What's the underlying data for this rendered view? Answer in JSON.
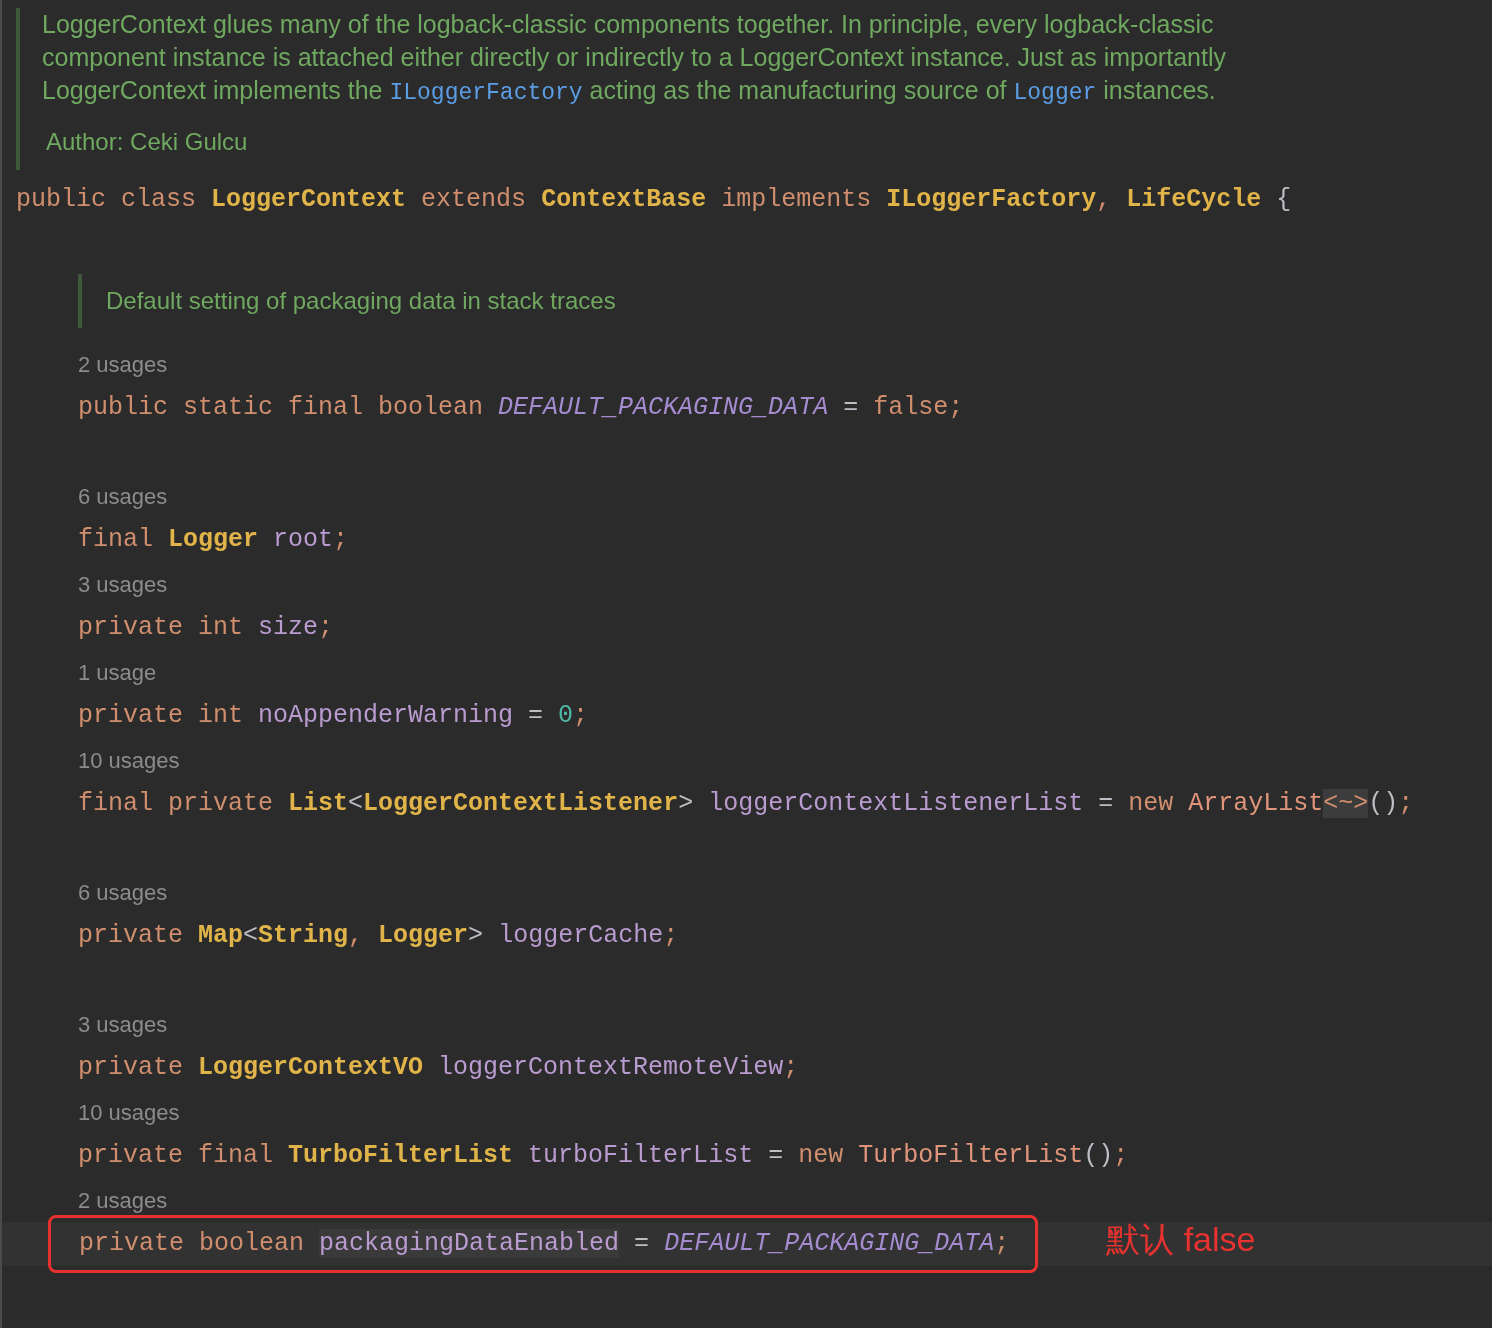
{
  "doc_comment": {
    "paragraph": [
      {
        "kind": "text",
        "text": "LoggerContext glues many of the logback-classic components together. In principle, every logback-classic component instance is attached either directly or indirectly to a LoggerContext instance. Just as importantly LoggerContext implements the "
      },
      {
        "kind": "code",
        "text": "ILoggerFactory"
      },
      {
        "kind": "text",
        "text": " acting as the manufacturing source of "
      },
      {
        "kind": "code",
        "text": "Logger"
      },
      {
        "kind": "text",
        "text": " instances."
      }
    ],
    "author": "Author: Ceki Gulcu"
  },
  "class_declaration": [
    {
      "text": "public class ",
      "kind": "kw"
    },
    {
      "text": "LoggerContext",
      "kind": "type"
    },
    {
      "text": " extends ",
      "kind": "kw"
    },
    {
      "text": "ContextBase",
      "kind": "type"
    },
    {
      "text": " implements ",
      "kind": "kw"
    },
    {
      "text": "ILoggerFactory",
      "kind": "type"
    },
    {
      "text": ", ",
      "kind": "kw"
    },
    {
      "text": "LifeCycle",
      "kind": "type"
    },
    {
      "text": " {",
      "kind": "op"
    }
  ],
  "members": [
    {
      "kind": "blank"
    },
    {
      "kind": "doc",
      "text": "Default setting of packaging data in stack traces"
    },
    {
      "kind": "usages",
      "text": "2 usages"
    },
    {
      "kind": "code",
      "boxed": false,
      "tokens": [
        {
          "text": "public static final boolean ",
          "kind": "kw"
        },
        {
          "text": "DEFAULT_PACKAGING_DATA",
          "kind": "const"
        },
        {
          "text": " = ",
          "kind": "op"
        },
        {
          "text": "false",
          "kind": "kw"
        },
        {
          "text": ";",
          "kind": "kw"
        }
      ]
    },
    {
      "kind": "blank"
    },
    {
      "kind": "usages",
      "text": "6 usages"
    },
    {
      "kind": "code",
      "boxed": false,
      "tokens": [
        {
          "text": "final ",
          "kind": "kw"
        },
        {
          "text": "Logger",
          "kind": "type"
        },
        {
          "text": " root",
          "kind": "field"
        },
        {
          "text": ";",
          "kind": "kw"
        }
      ]
    },
    {
      "kind": "usages",
      "text": "3 usages"
    },
    {
      "kind": "code",
      "boxed": false,
      "tokens": [
        {
          "text": "private int ",
          "kind": "kw"
        },
        {
          "text": "size",
          "kind": "field"
        },
        {
          "text": ";",
          "kind": "kw"
        }
      ]
    },
    {
      "kind": "usages",
      "text": "1 usage"
    },
    {
      "kind": "code",
      "boxed": false,
      "tokens": [
        {
          "text": "private int ",
          "kind": "kw"
        },
        {
          "text": "noAppenderWarning",
          "kind": "field"
        },
        {
          "text": " = ",
          "kind": "op"
        },
        {
          "text": "0",
          "kind": "num"
        },
        {
          "text": ";",
          "kind": "kw"
        }
      ]
    },
    {
      "kind": "usages",
      "text": "10 usages"
    },
    {
      "kind": "code",
      "boxed": false,
      "tokens": [
        {
          "text": "final private ",
          "kind": "kw"
        },
        {
          "text": "List",
          "kind": "type"
        },
        {
          "text": "<",
          "kind": "op"
        },
        {
          "text": "LoggerContextListener",
          "kind": "type"
        },
        {
          "text": "> ",
          "kind": "op"
        },
        {
          "text": "loggerContextListenerList",
          "kind": "field"
        },
        {
          "text": " = ",
          "kind": "op"
        },
        {
          "text": "new ",
          "kind": "kw"
        },
        {
          "text": "ArrayList",
          "kind": "ctor"
        },
        {
          "text": "<~>",
          "kind": "diamond"
        },
        {
          "text": "()",
          "kind": "op"
        },
        {
          "text": ";",
          "kind": "kw"
        }
      ]
    },
    {
      "kind": "blank"
    },
    {
      "kind": "usages",
      "text": "6 usages"
    },
    {
      "kind": "code",
      "boxed": false,
      "tokens": [
        {
          "text": "private ",
          "kind": "kw"
        },
        {
          "text": "Map",
          "kind": "type"
        },
        {
          "text": "<",
          "kind": "op"
        },
        {
          "text": "String",
          "kind": "type"
        },
        {
          "text": ", ",
          "kind": "kw"
        },
        {
          "text": "Logger",
          "kind": "type"
        },
        {
          "text": "> ",
          "kind": "op"
        },
        {
          "text": "loggerCache",
          "kind": "field"
        },
        {
          "text": ";",
          "kind": "kw"
        }
      ]
    },
    {
      "kind": "blank"
    },
    {
      "kind": "usages",
      "text": "3 usages"
    },
    {
      "kind": "code",
      "boxed": false,
      "tokens": [
        {
          "text": "private ",
          "kind": "kw"
        },
        {
          "text": "LoggerContextVO",
          "kind": "type"
        },
        {
          "text": " loggerContextRemoteView",
          "kind": "field"
        },
        {
          "text": ";",
          "kind": "kw"
        }
      ]
    },
    {
      "kind": "usages",
      "text": "10 usages"
    },
    {
      "kind": "code",
      "boxed": false,
      "tokens": [
        {
          "text": "private final ",
          "kind": "kw"
        },
        {
          "text": "TurboFilterList",
          "kind": "type"
        },
        {
          "text": " turboFilterList",
          "kind": "field"
        },
        {
          "text": " = ",
          "kind": "op"
        },
        {
          "text": "new ",
          "kind": "kw"
        },
        {
          "text": "TurboFilterList",
          "kind": "ctor"
        },
        {
          "text": "()",
          "kind": "op"
        },
        {
          "text": ";",
          "kind": "kw"
        }
      ]
    },
    {
      "kind": "usages",
      "text": "2 usages"
    },
    {
      "kind": "code",
      "boxed": true,
      "tokens": [
        {
          "text": "private boolean ",
          "kind": "kw"
        },
        {
          "text": "packagingDataEnabled",
          "kind": "field_marked"
        },
        {
          "text": " = ",
          "kind": "op"
        },
        {
          "text": "DEFAULT_PACKAGING_DATA",
          "kind": "const"
        },
        {
          "text": ";",
          "kind": "kw"
        }
      ]
    }
  ],
  "annotation": {
    "text": "默认 false"
  }
}
